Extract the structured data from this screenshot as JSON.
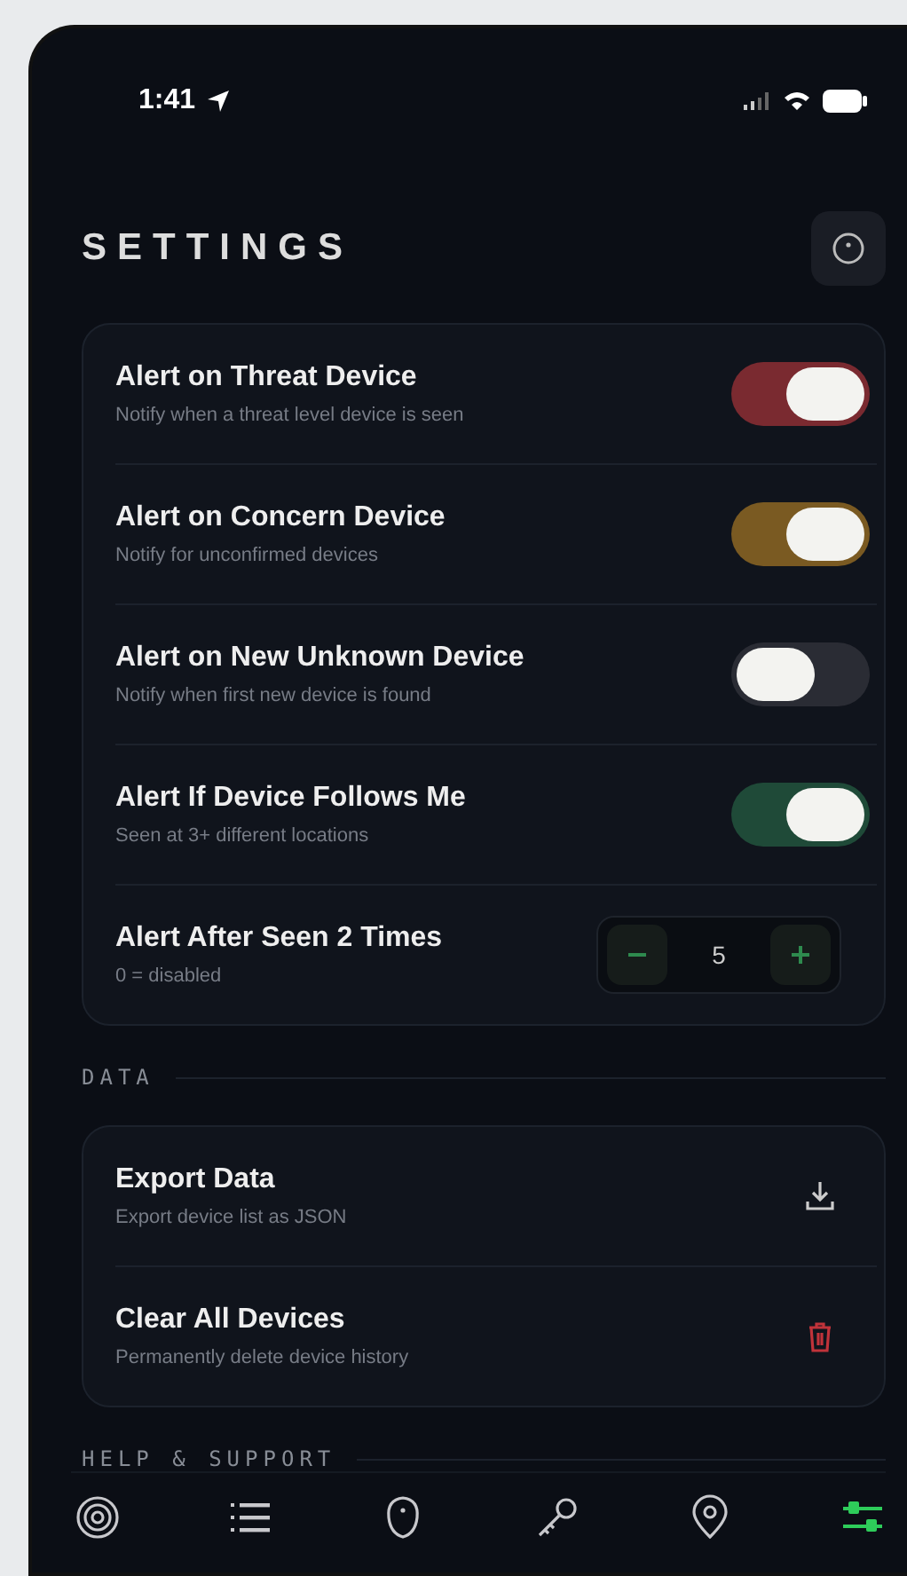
{
  "status_bar": {
    "time": "1:41"
  },
  "header": {
    "title": "SETTINGS"
  },
  "alerts": [
    {
      "kind": "toggle",
      "title": "Alert on Threat Device",
      "subtitle": "Notify when a threat level device is seen",
      "on": true,
      "color": "#7a2a30"
    },
    {
      "kind": "toggle",
      "title": "Alert on Concern Device",
      "subtitle": "Notify for unconfirmed devices",
      "on": true,
      "color": "#7a5a22"
    },
    {
      "kind": "toggle",
      "title": "Alert on New Unknown Device",
      "subtitle": "Notify when first new device is found",
      "on": false,
      "color": "#2a2c34"
    },
    {
      "kind": "toggle",
      "title": "Alert If Device Follows Me",
      "subtitle": "Seen at 3+ different locations",
      "on": true,
      "color": "#1f4a38"
    },
    {
      "kind": "stepper",
      "title": "Alert After Seen 2 Times",
      "subtitle": "0 = disabled",
      "value": "5"
    }
  ],
  "data_section": {
    "label": "DATA",
    "items": [
      {
        "kind": "export",
        "title": "Export Data",
        "subtitle": "Export device list as JSON"
      },
      {
        "kind": "delete",
        "title": "Clear All Devices",
        "subtitle": "Permanently delete device history"
      }
    ]
  },
  "help_section": {
    "label": "HELP & SUPPORT"
  },
  "bottom_nav": [
    {
      "kind": "radar",
      "selected": false
    },
    {
      "kind": "list",
      "selected": false
    },
    {
      "kind": "shield",
      "selected": false
    },
    {
      "kind": "key",
      "selected": false
    },
    {
      "kind": "pin",
      "selected": false
    },
    {
      "kind": "settings",
      "selected": true
    }
  ]
}
